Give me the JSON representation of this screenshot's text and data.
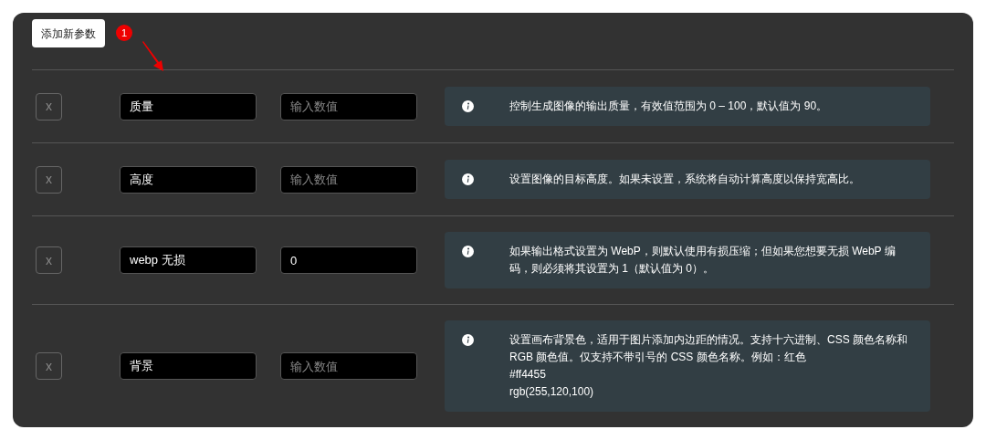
{
  "add_button": "添加新参数",
  "annotation": {
    "badge": "1"
  },
  "params": [
    {
      "remove": "x",
      "name": "质量",
      "value_placeholder": "输入数值",
      "info": [
        "控制生成图像的输出质量，有效值范围为 0 – 100，默认值为 90。"
      ]
    },
    {
      "remove": "x",
      "name": "高度",
      "value_placeholder": "输入数值",
      "info": [
        "设置图像的目标高度。如果未设置，系统将自动计算高度以保持宽高比。"
      ]
    },
    {
      "remove": "x",
      "name": "webp 无损",
      "value": "0",
      "info": [
        "如果输出格式设置为 WebP，则默认使用有损压缩；但如果您想要无损 WebP 编码，则必须将其设置为 1（默认值为 0）。"
      ]
    },
    {
      "remove": "x",
      "name": "背景",
      "value_placeholder": "输入数值",
      "info": [
        "设置画布背景色，适用于图片添加内边距的情况。支持十六进制、CSS 颜色名称和 RGB 颜色值。仅支持不带引号的 CSS 颜色名称。例如：红色",
        "#ff4455",
        "rgb(255,120,100)"
      ]
    }
  ]
}
